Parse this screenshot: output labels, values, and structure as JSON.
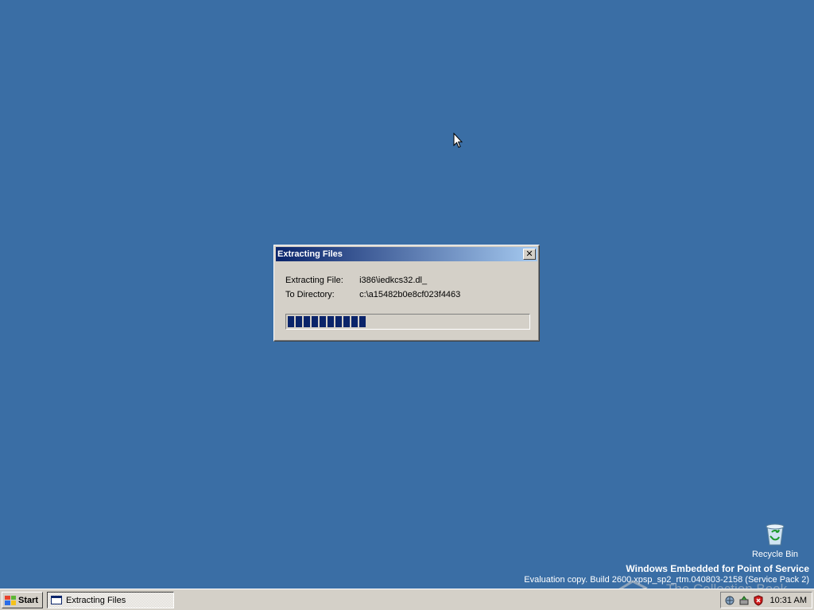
{
  "colors": {
    "desktop": "#3a6ea5",
    "title_active_start": "#0a246a",
    "title_active_end": "#a6caf0",
    "progress": "#0a246a",
    "face": "#d4d0c8"
  },
  "dialog": {
    "title": "Extracting Files",
    "close_icon": "close-icon",
    "extracting_file_label": "Extracting File:",
    "extracting_file_value": "i386\\iedkcs32.dl_",
    "to_directory_label": "To Directory:",
    "to_directory_value": "c:\\a15482b0e8cf023f4463",
    "progress_percent": 31
  },
  "desktop": {
    "recycle_bin_label": "Recycle Bin",
    "watermark_line1": "Windows Embedded for Point of Service",
    "watermark_line2": "Evaluation copy. Build 2600.xpsp_sp2_rtm.040803-2158 (Service Pack 2)",
    "overlay_text": "The Collection Book"
  },
  "taskbar": {
    "start_label": "Start",
    "task_label": "Extracting Files",
    "clock": "10:31 AM",
    "tray_icons": [
      "network-icon",
      "safely-remove-icon",
      "security-shield-icon"
    ]
  }
}
